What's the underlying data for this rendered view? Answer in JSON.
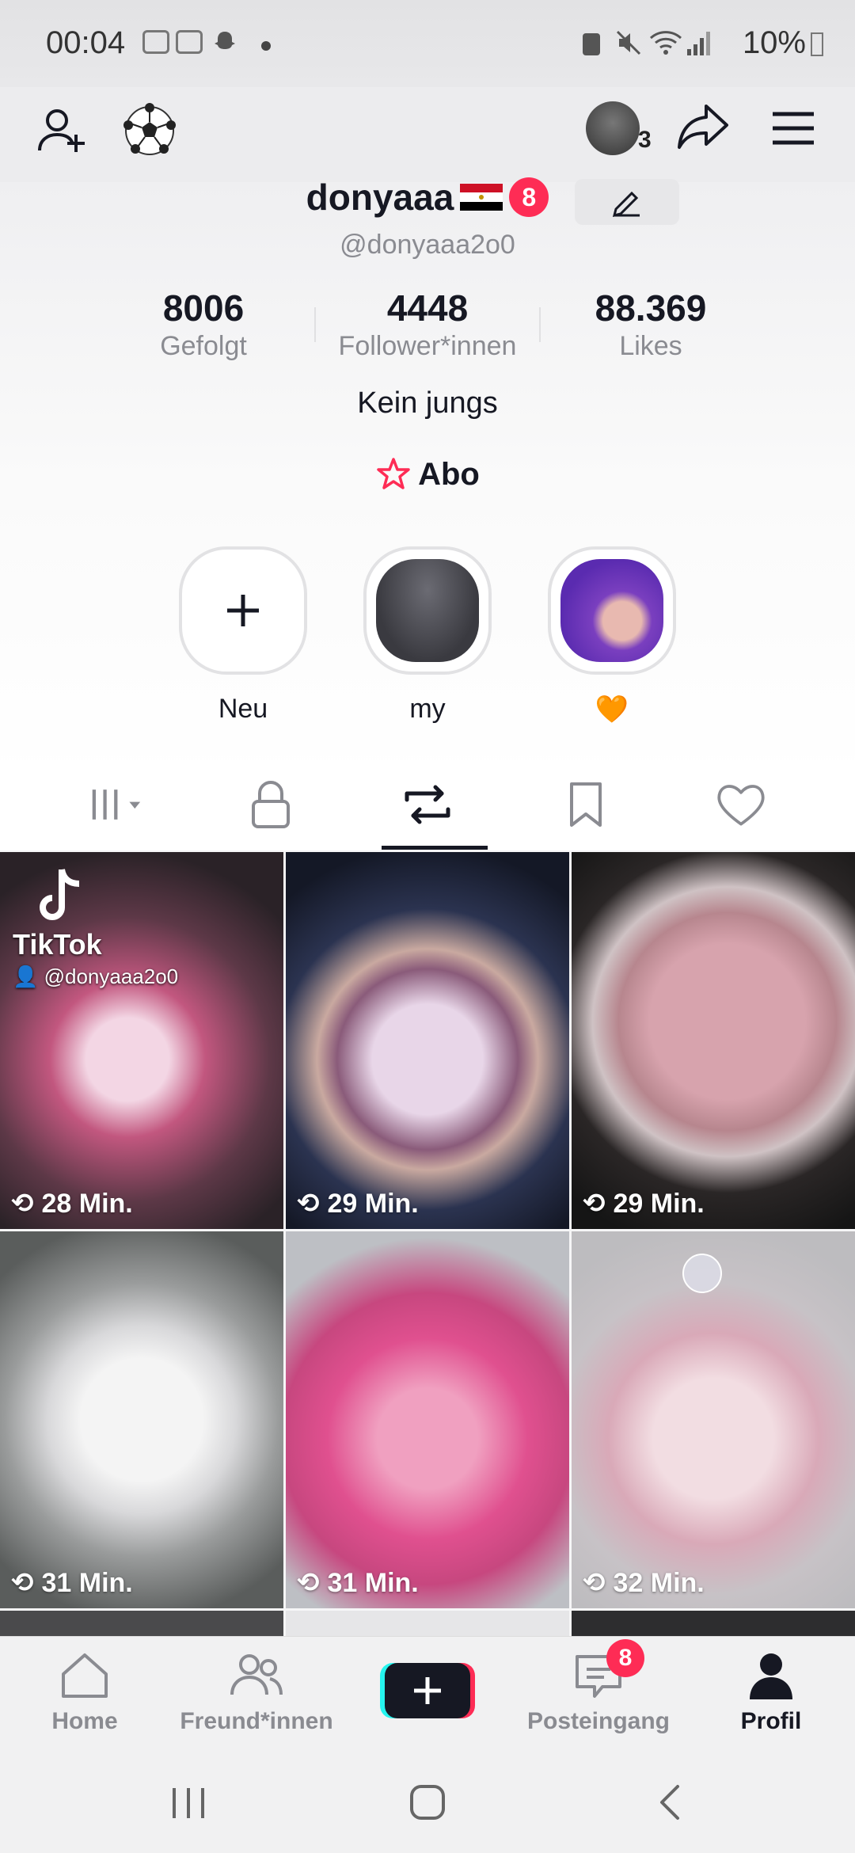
{
  "status_bar": {
    "time": "00:04",
    "battery": "10%"
  },
  "top_nav": {
    "icons": [
      "add-friend-icon",
      "soccer-ball-icon",
      "avatar",
      "share-icon",
      "menu-icon"
    ],
    "avatar_count": "3"
  },
  "profile": {
    "display_name": "donyaaa",
    "flag": "🇪🇬",
    "notification_badge": "8",
    "handle": "@donyaaa2o0",
    "stats": [
      {
        "value": "8006",
        "label": "Gefolgt"
      },
      {
        "value": "4448",
        "label": "Follower*innen"
      },
      {
        "value": "88.369",
        "label": "Likes"
      }
    ],
    "bio": "Kein jungs",
    "subscribe_label": "Abo"
  },
  "stories": [
    {
      "label": "Neu",
      "icon": "plus-icon"
    },
    {
      "label": "my"
    },
    {
      "label": "🧡"
    }
  ],
  "tabs": [
    {
      "icon": "grid-icon",
      "selected": false
    },
    {
      "icon": "lock-icon",
      "selected": false
    },
    {
      "icon": "repost-icon",
      "selected": true
    },
    {
      "icon": "bookmark-icon",
      "selected": false
    },
    {
      "icon": "heart-icon",
      "selected": false
    }
  ],
  "videos": [
    {
      "time": "28 Min.",
      "watermark": "TikTok",
      "watermark_handle": "@donyaaa2o0"
    },
    {
      "time": "29 Min."
    },
    {
      "time": "29 Min."
    },
    {
      "time": "31 Min."
    },
    {
      "time": "31 Min."
    },
    {
      "time": "32 Min."
    }
  ],
  "bottom_nav": {
    "items": [
      {
        "label": "Home",
        "icon": "home-icon"
      },
      {
        "label": "Freund*innen",
        "icon": "friends-icon"
      },
      {
        "label": "",
        "icon": "create-plus-icon"
      },
      {
        "label": "Posteingang",
        "icon": "inbox-icon",
        "badge": "8"
      },
      {
        "label": "Profil",
        "icon": "profile-icon",
        "active": true
      }
    ]
  },
  "colors": {
    "accent": "#fe2c55",
    "text": "#161823",
    "secondary": "#8a8b91"
  }
}
